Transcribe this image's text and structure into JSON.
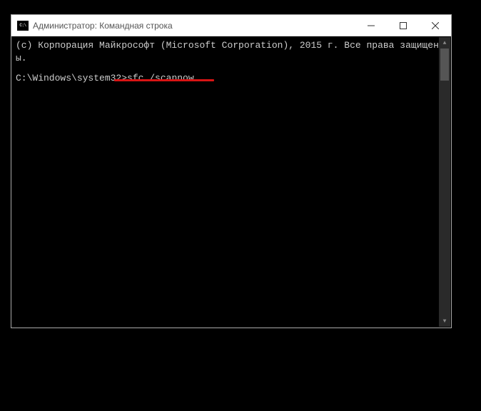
{
  "window": {
    "title": "Администратор: Командная строка"
  },
  "console": {
    "line1": "(с) Корпорация Майкрософт (Microsoft Corporation), 2015 г. Все права защищены.",
    "prompt": "C:\\Windows\\system32>",
    "command": "sfc /scannow"
  }
}
